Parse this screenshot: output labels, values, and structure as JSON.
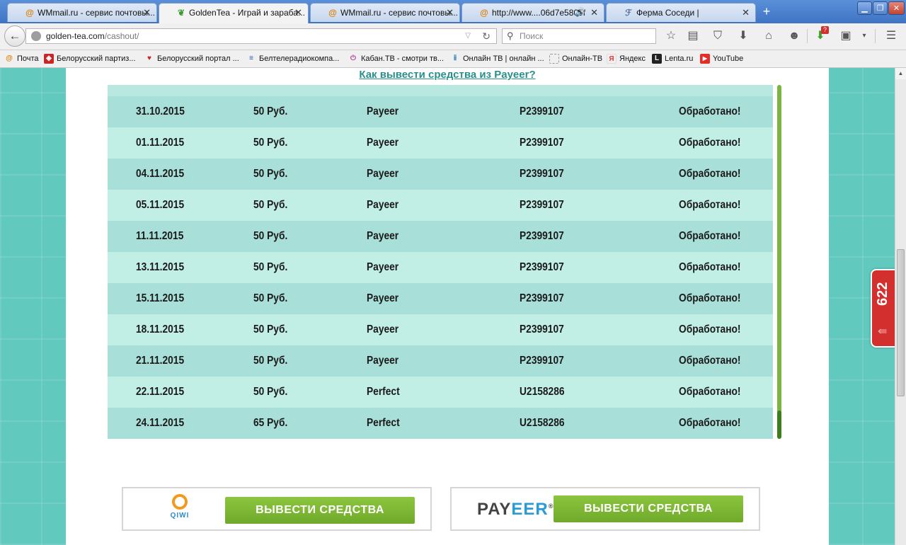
{
  "browser": {
    "tabs": [
      {
        "title": "WMmail.ru - сервис почтовы...",
        "icon": "at-icon"
      },
      {
        "title": "GoldenTea - Играй и зараба...",
        "icon": "leaf-icon",
        "active": true
      },
      {
        "title": "WMmail.ru - сервис почтовы...",
        "icon": "at-icon"
      },
      {
        "title": "http://www....06d7e5805f",
        "icon": "at-icon",
        "sound": true
      },
      {
        "title": "Ферма Соседи |",
        "icon": "farm-icon"
      }
    ],
    "url_host": "golden-tea.com",
    "url_path": "/cashout/",
    "search_placeholder": "Поиск",
    "bookmarks": [
      "Почта",
      "Белорусский партиз...",
      "Белорусский портал ...",
      "Белтелерадиокомпа...",
      "Кабан.ТВ - смотри тв...",
      "Онлайн ТВ | онлайн ...",
      "Онлайн-ТВ",
      "Яндекс",
      "Lenta.ru",
      "YouTube"
    ],
    "notification_badge": "?"
  },
  "page": {
    "help_link": "Как вывести средства из Payeer?",
    "payouts": [
      {
        "date": "31.10.2015",
        "amount": "50 Руб.",
        "system": "Payeer",
        "account": "P2399107",
        "status": "Обработано!"
      },
      {
        "date": "01.11.2015",
        "amount": "50 Руб.",
        "system": "Payeer",
        "account": "P2399107",
        "status": "Обработано!"
      },
      {
        "date": "04.11.2015",
        "amount": "50 Руб.",
        "system": "Payeer",
        "account": "P2399107",
        "status": "Обработано!"
      },
      {
        "date": "05.11.2015",
        "amount": "50 Руб.",
        "system": "Payeer",
        "account": "P2399107",
        "status": "Обработано!"
      },
      {
        "date": "11.11.2015",
        "amount": "50 Руб.",
        "system": "Payeer",
        "account": "P2399107",
        "status": "Обработано!"
      },
      {
        "date": "13.11.2015",
        "amount": "50 Руб.",
        "system": "Payeer",
        "account": "P2399107",
        "status": "Обработано!"
      },
      {
        "date": "15.11.2015",
        "amount": "50 Руб.",
        "system": "Payeer",
        "account": "P2399107",
        "status": "Обработано!"
      },
      {
        "date": "18.11.2015",
        "amount": "50 Руб.",
        "system": "Payeer",
        "account": "P2399107",
        "status": "Обработано!"
      },
      {
        "date": "21.11.2015",
        "amount": "50 Руб.",
        "system": "Payeer",
        "account": "P2399107",
        "status": "Обработано!"
      },
      {
        "date": "22.11.2015",
        "amount": "50 Руб.",
        "system": "Perfect",
        "account": "U2158286",
        "status": "Обработано!"
      },
      {
        "date": "24.11.2015",
        "amount": "65 Руб.",
        "system": "Perfect",
        "account": "U2158286",
        "status": "Обработано!"
      }
    ],
    "qiwi": {
      "logo_text": "QIWI",
      "button_label": "ВЫВЕСТИ СРЕДСТВА"
    },
    "payeer": {
      "logo_pay": "PAY",
      "logo_eer": "EER",
      "logo_reg": "®",
      "button_label": "ВЫВЕСТИ СРЕДСТВА"
    },
    "counter": "622"
  },
  "colors": {
    "accent_green": "#7cb342",
    "row_dark": "#a9dfd9",
    "row_light": "#c1eee5",
    "link": "#2a8f8a",
    "background_teal": "#62c9bf"
  }
}
